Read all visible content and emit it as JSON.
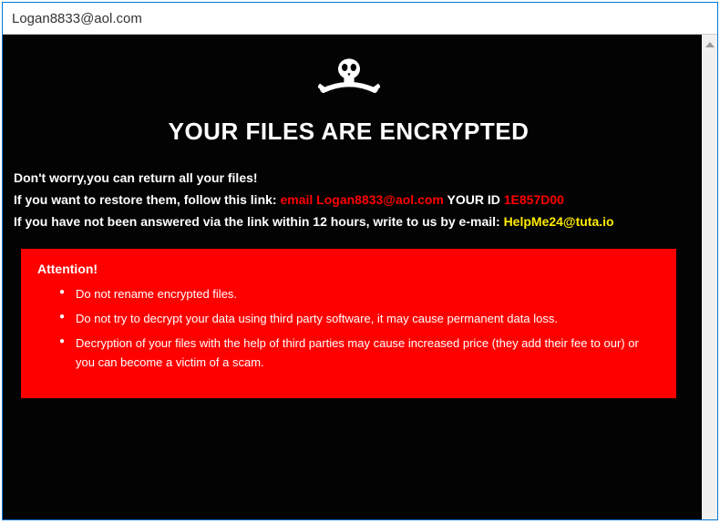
{
  "window": {
    "title": "Logan8833@aol.com"
  },
  "heading": "YOUR FILES ARE ENCRYPTED",
  "line1": "Don't worry,you can return all your files!",
  "line2_prefix": "If you want to restore them, follow this link: ",
  "line2_email_label": "email ",
  "line2_email": "Logan8833@aol.com",
  "line2_yourid_label": "  YOUR ID ",
  "line2_yourid": "1E857D00",
  "line3_prefix": "If you have not been answered via the link within 12 hours, write to us by e-mail: ",
  "line3_email": "HelpMe24@tuta.io",
  "attention": {
    "title": "Attention!",
    "items": [
      "Do not rename encrypted files.",
      "Do not try to decrypt your data using third party software, it may cause permanent data loss.",
      "Decryption of your files with the help of third parties may cause increased price (they add their fee to our) or you can become a victim of a scam."
    ]
  }
}
